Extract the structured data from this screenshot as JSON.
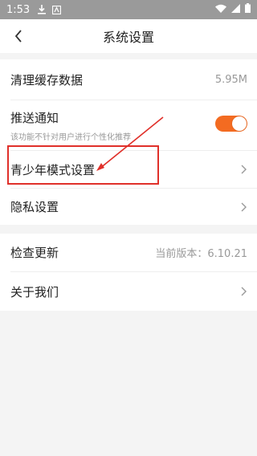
{
  "status_bar": {
    "time": "1:53",
    "icons": [
      "download-icon",
      "notification-icon",
      "wifi-icon",
      "signal-icon",
      "battery-icon"
    ]
  },
  "header": {
    "back_icon": "chevron-left-icon",
    "title": "系统设置"
  },
  "settings": {
    "clear_cache": {
      "label": "清理缓存数据",
      "value": "5.95M"
    },
    "push_notification": {
      "label": "推送通知",
      "description": "该功能不针对用户进行个性化推荐",
      "enabled": true
    },
    "youth_mode": {
      "label": "青少年模式设置"
    },
    "privacy": {
      "label": "隐私设置"
    },
    "check_update": {
      "label": "检查更新",
      "value": "当前版本：6.10.21"
    },
    "about": {
      "label": "关于我们"
    }
  },
  "colors": {
    "accent": "#f36b21",
    "annotation": "#e0302a",
    "status_bar": "#9a9a9a"
  }
}
